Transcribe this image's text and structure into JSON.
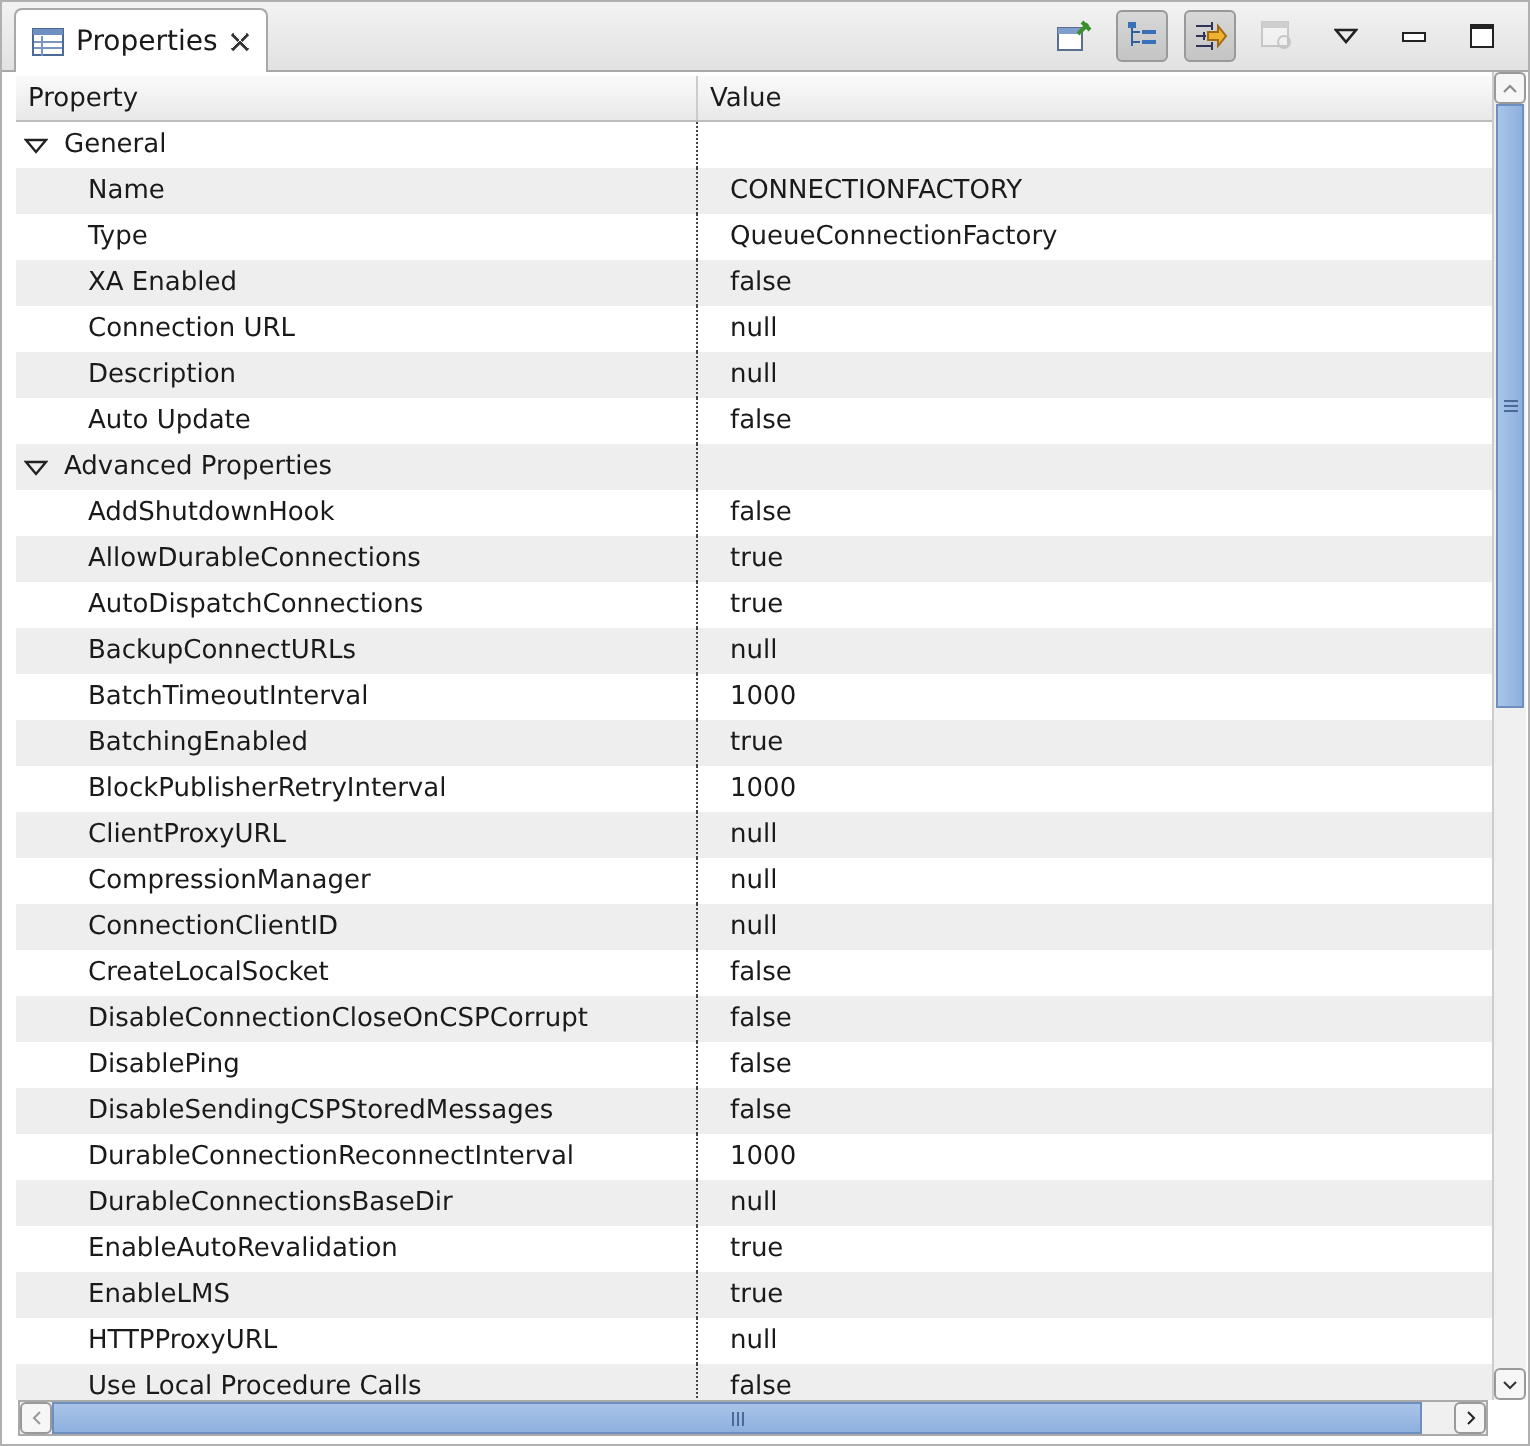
{
  "tab": {
    "title": "Properties",
    "selected": true
  },
  "toolbar": [
    {
      "kind": "pin",
      "pressed": false,
      "disabled": false
    },
    {
      "kind": "tree",
      "pressed": true,
      "disabled": false
    },
    {
      "kind": "filter",
      "pressed": true,
      "disabled": false
    },
    {
      "kind": "restore",
      "pressed": false,
      "disabled": true
    },
    {
      "kind": "menu",
      "pressed": false,
      "disabled": false
    },
    {
      "kind": "minimize",
      "pressed": false,
      "disabled": false
    },
    {
      "kind": "maximize",
      "pressed": false,
      "disabled": false
    }
  ],
  "table": {
    "columns": [
      "Property",
      "Value"
    ],
    "groups": [
      {
        "name": "General",
        "expanded": true,
        "children": [
          {
            "property": "Name",
            "value": "CONNECTIONFACTORY"
          },
          {
            "property": "Type",
            "value": "QueueConnectionFactory"
          },
          {
            "property": "XA Enabled",
            "value": "false"
          },
          {
            "property": "Connection URL",
            "value": "null"
          },
          {
            "property": "Description",
            "value": "null"
          },
          {
            "property": "Auto Update",
            "value": "false"
          }
        ]
      },
      {
        "name": "Advanced Properties",
        "expanded": true,
        "children": [
          {
            "property": "AddShutdownHook",
            "value": "false"
          },
          {
            "property": "AllowDurableConnections",
            "value": "true"
          },
          {
            "property": "AutoDispatchConnections",
            "value": "true"
          },
          {
            "property": "BackupConnectURLs",
            "value": "null"
          },
          {
            "property": "BatchTimeoutInterval",
            "value": "1000"
          },
          {
            "property": "BatchingEnabled",
            "value": "true"
          },
          {
            "property": "BlockPublisherRetryInterval",
            "value": "1000"
          },
          {
            "property": "ClientProxyURL",
            "value": "null"
          },
          {
            "property": "CompressionManager",
            "value": "null"
          },
          {
            "property": "ConnectionClientID",
            "value": "null"
          },
          {
            "property": "CreateLocalSocket",
            "value": "false"
          },
          {
            "property": "DisableConnectionCloseOnCSPCorrupt",
            "value": "false"
          },
          {
            "property": "DisablePing",
            "value": "false"
          },
          {
            "property": "DisableSendingCSPStoredMessages",
            "value": "false"
          },
          {
            "property": "DurableConnectionReconnectInterval",
            "value": "1000"
          },
          {
            "property": "DurableConnectionsBaseDir",
            "value": "null"
          },
          {
            "property": "EnableAutoRevalidation",
            "value": "true"
          },
          {
            "property": "EnableLMS",
            "value": "true"
          },
          {
            "property": "HTTPProxyURL",
            "value": "null"
          },
          {
            "property": "Use Local Procedure Calls",
            "value": "false"
          }
        ]
      }
    ]
  }
}
